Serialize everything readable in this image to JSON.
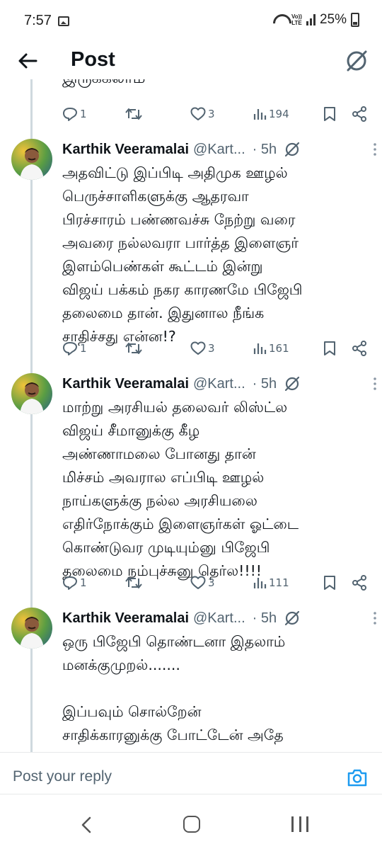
{
  "status_bar": {
    "time": "7:57",
    "lte_top": "Vo))",
    "lte_bottom": "LTE",
    "battery": "25%"
  },
  "header": {
    "title": "Post"
  },
  "clipped_text": "இருக்கலாம",
  "first_actions": {
    "replies": "1",
    "retweets": "",
    "likes": "3",
    "views": "194"
  },
  "tweets": [
    {
      "name": "Karthik Veeramalai",
      "handle": "@Kart...",
      "time": "· 5h",
      "body": "அதவிட்டு இப்பிடி அதிமுக ஊழல்\nபெருச்சாளிகளுக்கு ஆதரவா\nபிரச்சாரம் பண்ணவச்சு நேற்று வரை\nஅவரை நல்லவரா பார்த்த இளைஞர்\nஇளம்பெண்கள் கூட்டம் இன்று\nவிஜய் பக்கம் நகர காரணமே பிஜேபி\nதலைமை தான். இதுனால நீங்க\nசாதிச்சது என்ன!?",
      "actions": {
        "replies": "1",
        "likes": "3",
        "views": "161"
      }
    },
    {
      "name": "Karthik Veeramalai",
      "handle": "@Kart...",
      "time": "· 5h",
      "body": "மாற்று அரசியல் தலைவர் லிஸ்ட்ல\nவிஜய் சீமானுக்கு கீழ\nஅண்ணாமலை போனது தான்\nமிச்சம் அவரால எப்பிடி ஊழல்\nநாய்களுக்கு நல்ல அரசியலை\nஎதிர்நோக்கும் இளைஞர்கள் ஓட்டை\nகொண்டுவர முடியும்னு பிஜேபி\nதலைமை நம்புச்சுனு தெர்ல!!!!",
      "actions": {
        "replies": "1",
        "likes": "3",
        "views": "111"
      }
    },
    {
      "name": "Karthik Veeramalai",
      "handle": "@Kart...",
      "time": "· 5h",
      "body": "ஒரு பிஜேபி தொண்டனா இதலாம்\nமனக்குமுறல்.......\n\nஇப்பவும் சொல்றேன்\nசாதிக்காரனுக்கு போட்டேன் அதே\nசாதியை எதிர்க்கும் திமுக க்கு அனா",
      "actions": {
        "replies": "",
        "likes": "",
        "views": ""
      }
    }
  ],
  "reply_bar": {
    "placeholder": "Post your reply"
  },
  "colors": {
    "text": "#0f1419",
    "secondary": "#536471",
    "accent": "#1d9bf0",
    "thread_line": "#cfd9de"
  },
  "icons": [
    "back-arrow-icon",
    "grok-icon",
    "reply-icon",
    "retweet-icon",
    "like-icon",
    "views-icon",
    "bookmark-icon",
    "share-icon",
    "more-icon",
    "camera-icon"
  ]
}
